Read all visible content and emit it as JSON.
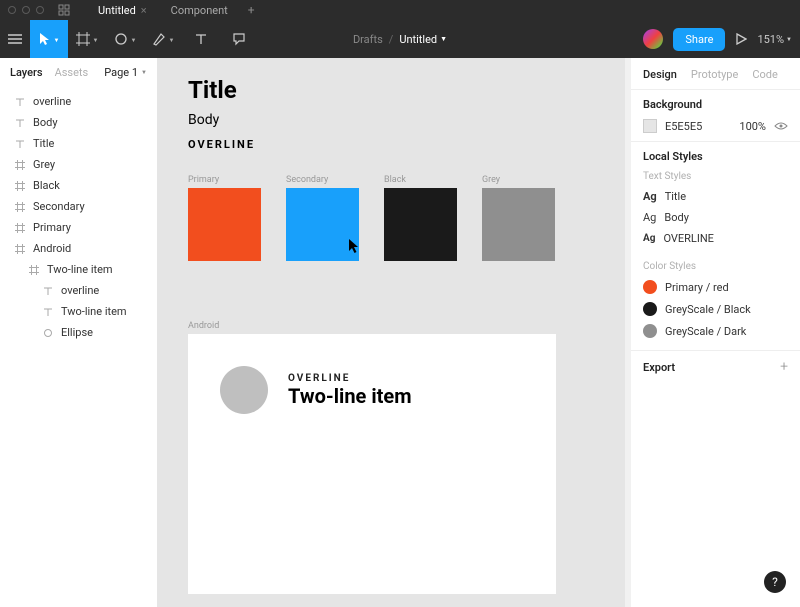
{
  "titlebar": {
    "tabs": [
      {
        "label": "Untitled",
        "active": true
      },
      {
        "label": "Component",
        "active": false
      }
    ]
  },
  "toolbar": {
    "breadcrumb_folder": "Drafts",
    "breadcrumb_file": "Untitled",
    "share_label": "Share",
    "zoom": "151%"
  },
  "left_panel": {
    "tabs": {
      "layers": "Layers",
      "assets": "Assets",
      "page": "Page 1"
    },
    "layers": [
      {
        "icon": "text",
        "label": "overline",
        "indent": 0
      },
      {
        "icon": "text",
        "label": "Body",
        "indent": 0
      },
      {
        "icon": "text",
        "label": "Title",
        "indent": 0
      },
      {
        "icon": "frame",
        "label": "Grey",
        "indent": 0
      },
      {
        "icon": "frame",
        "label": "Black",
        "indent": 0
      },
      {
        "icon": "frame",
        "label": "Secondary",
        "indent": 0
      },
      {
        "icon": "frame",
        "label": "Primary",
        "indent": 0
      },
      {
        "icon": "frame",
        "label": "Android",
        "indent": 0
      },
      {
        "icon": "frame",
        "label": "Two-line item",
        "indent": 1
      },
      {
        "icon": "text",
        "label": "overline",
        "indent": 2
      },
      {
        "icon": "text",
        "label": "Two-line item",
        "indent": 2
      },
      {
        "icon": "ellipse",
        "label": "Ellipse",
        "indent": 2
      }
    ]
  },
  "canvas": {
    "title": "Title",
    "body": "Body",
    "overline": "OVERLINE",
    "swatches": [
      {
        "label": "Primary",
        "color": "#f24e1e"
      },
      {
        "label": "Secondary",
        "color": "#18a0fb"
      },
      {
        "label": "Black",
        "color": "#1a1a1a"
      },
      {
        "label": "Grey",
        "color": "#8f8f8f"
      }
    ],
    "android": {
      "frame_label": "Android",
      "overline": "OVERLINE",
      "two_line": "Two-line item"
    }
  },
  "right_panel": {
    "tabs": {
      "design": "Design",
      "prototype": "Prototype",
      "code": "Code"
    },
    "background": {
      "heading": "Background",
      "hex": "E5E5E5",
      "opacity": "100%"
    },
    "local_styles": {
      "heading": "Local Styles",
      "text_heading": "Text Styles",
      "text_styles": [
        {
          "ag_class": "bold",
          "name": "Title"
        },
        {
          "ag_class": "thin",
          "name": "Body"
        },
        {
          "ag_class": "ov",
          "name": "OVERLINE"
        }
      ],
      "color_heading": "Color Styles",
      "color_styles": [
        {
          "color": "#f24e1e",
          "name": "Primary / red"
        },
        {
          "color": "#1a1a1a",
          "name": "GreyScale / Black"
        },
        {
          "color": "#8f8f8f",
          "name": "GreyScale / Dark"
        }
      ]
    },
    "export": {
      "heading": "Export"
    }
  },
  "help": "?"
}
